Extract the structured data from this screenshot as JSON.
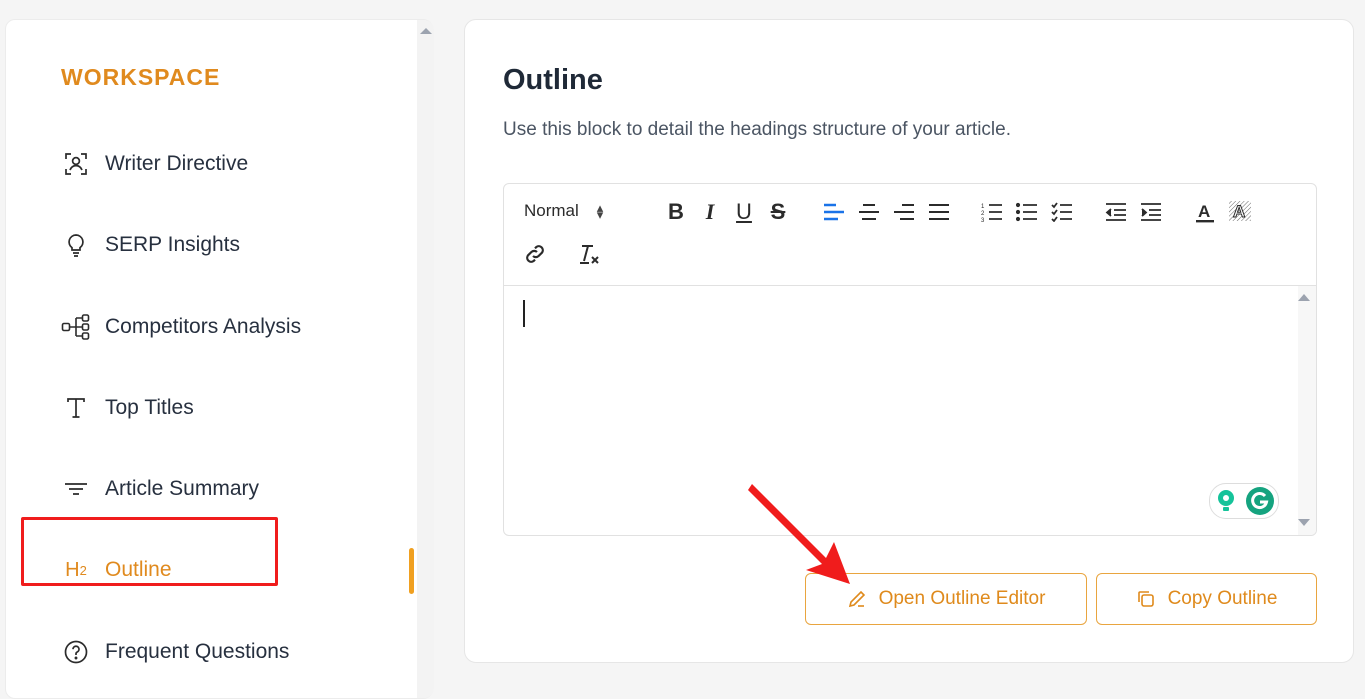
{
  "sidebar": {
    "section_title": "WORKSPACE",
    "items": [
      {
        "label": "Writer Directive",
        "icon": "user-scan-icon"
      },
      {
        "label": "SERP Insights",
        "icon": "lightbulb-icon"
      },
      {
        "label": "Competitors Analysis",
        "icon": "hierarchy-icon"
      },
      {
        "label": "Top Titles",
        "icon": "text-t-icon"
      },
      {
        "label": "Article Summary",
        "icon": "lines-icon"
      },
      {
        "label": "Outline",
        "icon": "h2-icon",
        "active": true
      },
      {
        "label": "Frequent Questions",
        "icon": "question-circle-icon"
      }
    ]
  },
  "main": {
    "title": "Outline",
    "description": "Use this block to detail the headings structure of your article.",
    "editor": {
      "format_value": "Normal",
      "content": ""
    },
    "buttons": {
      "open_editor": "Open Outline Editor",
      "copy": "Copy Outline"
    }
  },
  "colors": {
    "accent": "#e08a1e",
    "highlight": "#f01c1c",
    "align_active": "#1a73e8"
  }
}
